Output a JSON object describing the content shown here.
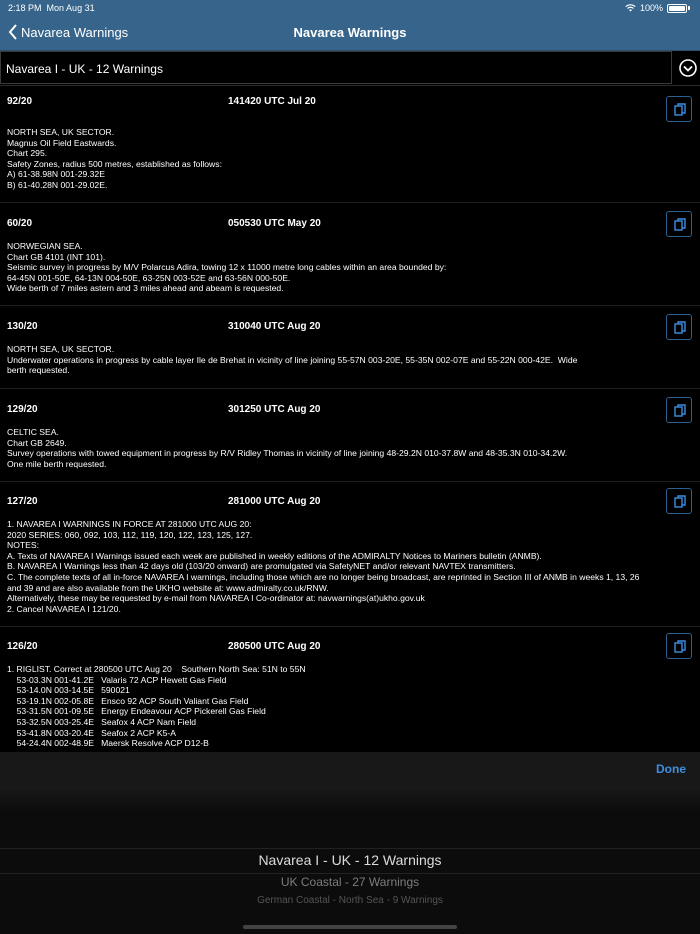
{
  "status_bar": {
    "time": "2:18 PM",
    "date": "Mon Aug 31",
    "battery": "100%"
  },
  "nav": {
    "back_label": "Navarea Warnings",
    "title": "Navarea Warnings"
  },
  "selector": {
    "label": "Navarea I - UK  -  12 Warnings"
  },
  "warnings": [
    {
      "number": "92/20",
      "datetime": "141420 UTC Jul 20",
      "text": "NORTH SEA, UK SECTOR.\nMagnus Oil Field Eastwards.\nChart 295.\nSafety Zones, radius 500 metres, established as follows:\nA) 61-38.98N 001-29.32E\nB) 61-40.28N 001-29.02E."
    },
    {
      "number": "60/20",
      "datetime": "050530 UTC May 20",
      "text": "NORWEGIAN SEA.\nChart GB 4101 (INT 101).\nSeismic survey in progress by M/V Polarcus Adira, towing 12 x 11000 metre long cables within an area bounded by:\n64-45N 001-50E, 64-13N 004-50E, 63-25N 003-52E and 63-56N 000-50E.\nWide berth of 7 miles astern and 3 miles ahead and abeam is requested."
    },
    {
      "number": "130/20",
      "datetime": "310040 UTC Aug 20",
      "text": "NORTH SEA, UK SECTOR.\nUnderwater operations in progress by cable layer Ile de Brehat in vicinity of line joining 55-57N 003-20E, 55-35N 002-07E and 55-22N 000-42E.  Wide\nberth requested."
    },
    {
      "number": "129/20",
      "datetime": "301250 UTC Aug 20",
      "text": "CELTIC SEA.\nChart GB 2649.\nSurvey operations with towed equipment in progress by R/V Ridley Thomas in vicinity of line joining 48-29.2N 010-37.8W and 48-35.3N 010-34.2W.\nOne mile berth requested."
    },
    {
      "number": "127/20",
      "datetime": "281000 UTC Aug 20",
      "text": "1. NAVAREA I WARNINGS IN FORCE AT 281000 UTC AUG 20:\n2020 SERIES: 060, 092, 103, 112, 119, 120, 122, 123, 125, 127.\nNOTES:\nA. Texts of NAVAREA I Warnings issued each week are published in weekly editions of the ADMIRALTY Notices to Mariners bulletin (ANMB).\nB. NAVAREA I Warnings less than 42 days old (103/20 onward) are promulgated via SafetyNET and/or relevant NAVTEX transmitters.\nC. The complete texts of all in-force NAVAREA I warnings, including those which are no longer being broadcast, are reprinted in Section III of ANMB in weeks 1, 13, 26\nand 39 and are also available from the UKHO website at: www.admiralty.co.uk/RNW.\nAlternatively, these may be requested by e-mail from NAVAREA I Co-ordinator at: navwarnings(at)ukho.gov.uk\n2. Cancel NAVAREA I 121/20."
    },
    {
      "number": "126/20",
      "datetime": "280500 UTC Aug 20",
      "text": "1. RIGLIST. Correct at 280500 UTC Aug 20    Southern North Sea: 51N to 55N\n    53-03.3N 001-41.2E   Valaris 72 ACP Hewett Gas Field\n    53-14.0N 003-14.5E   590021\n    53-19.1N 002-05.8E   Ensco 92 ACP South Valiant Gas Field\n    53-31.5N 001-09.5E   Energy Endeavour ACP Pickerell Gas Field\n    53-32.5N 003-25.4E   Seafox 4 ACP Nam Field\n    53-41.8N 003-20.4E   Seafox 2 ACP K5-A\n    54-24.4N 002-48.9E   Maersk Resolve ACP D12-B"
    }
  ],
  "picker": {
    "done_label": "Done",
    "options": [
      "Navarea I - UK  -  12 Warnings",
      "UK Coastal  -  27 Warnings",
      "German Coastal - North Sea  -  9 Warnings"
    ]
  }
}
